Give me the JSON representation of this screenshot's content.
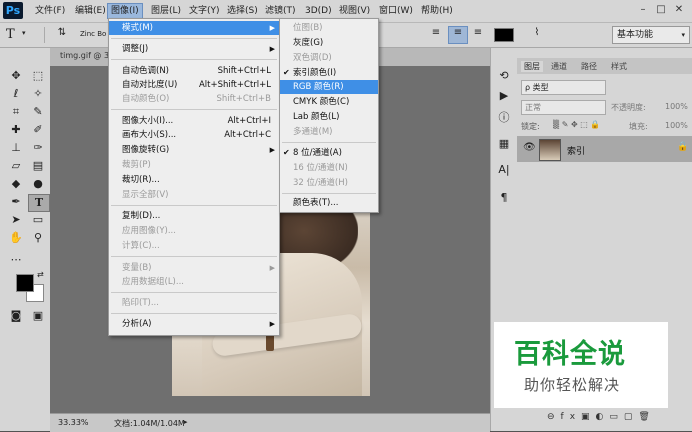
{
  "app_logo": "Ps",
  "menubar": [
    {
      "label": "文件(F)"
    },
    {
      "label": "编辑(E)"
    },
    {
      "label": "图像(I)"
    },
    {
      "label": "图层(L)"
    },
    {
      "label": "文字(Y)"
    },
    {
      "label": "选择(S)"
    },
    {
      "label": "滤镜(T)"
    },
    {
      "label": "3D(D)"
    },
    {
      "label": "视图(V)"
    },
    {
      "label": "窗口(W)"
    },
    {
      "label": "帮助(H)"
    }
  ],
  "window_controls": {
    "minimize": "–",
    "restore": "□",
    "close": "✕"
  },
  "options_bar": {
    "font_preview": "Zinc Bo",
    "workspace": "基本功能"
  },
  "document_tab": {
    "label": "timg.gif @ 3"
  },
  "status_bar": {
    "zoom": "33.33%",
    "doc_info": "文档:1.04M/1.04M"
  },
  "image_menu": {
    "items": [
      {
        "label": "模式(M)",
        "shortcut": "",
        "submenu": true,
        "disabled": false,
        "highlighted": true
      },
      {
        "label": "调整(J)",
        "shortcut": "",
        "submenu": true,
        "disabled": false
      },
      {
        "label": "自动色调(N)",
        "shortcut": "Shift+Ctrl+L",
        "disabled": false
      },
      {
        "label": "自动对比度(U)",
        "shortcut": "Alt+Shift+Ctrl+L",
        "disabled": false
      },
      {
        "label": "自动颜色(O)",
        "shortcut": "Shift+Ctrl+B",
        "disabled": true
      },
      {
        "label": "图像大小(I)...",
        "shortcut": "Alt+Ctrl+I",
        "disabled": false
      },
      {
        "label": "画布大小(S)...",
        "shortcut": "Alt+Ctrl+C",
        "disabled": false
      },
      {
        "label": "图像旋转(G)",
        "shortcut": "",
        "submenu": true,
        "disabled": false
      },
      {
        "label": "裁剪(P)",
        "shortcut": "",
        "disabled": true
      },
      {
        "label": "裁切(R)...",
        "shortcut": "",
        "disabled": false
      },
      {
        "label": "显示全部(V)",
        "shortcut": "",
        "disabled": true
      },
      {
        "label": "复制(D)...",
        "shortcut": "",
        "disabled": false
      },
      {
        "label": "应用图像(Y)...",
        "shortcut": "",
        "disabled": true
      },
      {
        "label": "计算(C)...",
        "shortcut": "",
        "disabled": true
      },
      {
        "label": "变量(B)",
        "shortcut": "",
        "submenu": true,
        "disabled": true
      },
      {
        "label": "应用数据组(L)...",
        "shortcut": "",
        "disabled": true
      },
      {
        "label": "陷印(T)...",
        "shortcut": "",
        "disabled": true
      },
      {
        "label": "分析(A)",
        "shortcut": "",
        "submenu": true,
        "disabled": false
      }
    ]
  },
  "mode_submenu": {
    "items": [
      {
        "label": "位图(B)",
        "disabled": true
      },
      {
        "label": "灰度(G)",
        "disabled": false
      },
      {
        "label": "双色调(D)",
        "disabled": true
      },
      {
        "label": "索引颜色(I)",
        "disabled": false,
        "checked": true
      },
      {
        "label": "RGB 颜色(R)",
        "disabled": false,
        "highlighted": true
      },
      {
        "label": "CMYK 颜色(C)",
        "disabled": false
      },
      {
        "label": "Lab 颜色(L)",
        "disabled": false
      },
      {
        "label": "多通道(M)",
        "disabled": true
      },
      {
        "label": "8 位/通道(A)",
        "disabled": false,
        "checked": true
      },
      {
        "label": "16 位/通道(N)",
        "disabled": true
      },
      {
        "label": "32 位/通道(H)",
        "disabled": true
      },
      {
        "label": "颜色表(T)...",
        "disabled": false
      }
    ]
  },
  "layers_panel": {
    "tabs": [
      "图层",
      "通道",
      "路径",
      "样式"
    ],
    "filter": "ρ 类型",
    "blend_mode": "正常",
    "opacity_label": "不透明度:",
    "opacity_value": "100%",
    "lock_label": "锁定:",
    "fill_label": "填充:",
    "fill_value": "100%",
    "layer_name": "索引"
  },
  "watermark": {
    "title": "百科全说",
    "subtitle": "助你轻松解决"
  },
  "colors": {
    "highlight": "#3f8fe6",
    "menu_active": "#9ab8dd",
    "watermark_text": "#1a9a3c"
  }
}
